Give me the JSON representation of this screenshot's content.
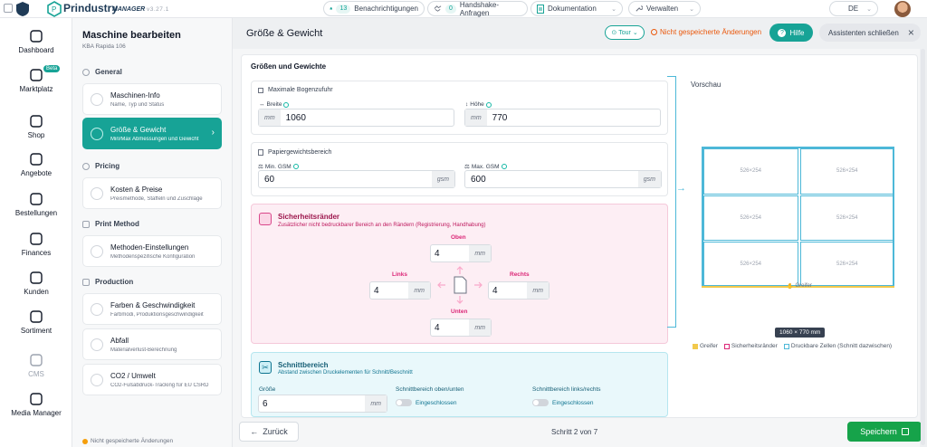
{
  "topbar": {
    "brand": "Prindustry",
    "brand_sub": "MANAGER",
    "version": "v3.27.1",
    "notifications": {
      "count": "13",
      "label": "Benachrichtigungen"
    },
    "handshake": {
      "count": "0",
      "label": "Handshake-Anfragen"
    },
    "docs_label": "Dokumentation",
    "manage_label": "Verwalten",
    "language": "DE"
  },
  "nav": [
    {
      "label": "Dashboard",
      "icon": "dashboard-icon"
    },
    {
      "label": "Marktplatz",
      "icon": "marketplace-icon",
      "badge": "Beta"
    },
    {
      "label": "Shop",
      "icon": "shop-icon"
    },
    {
      "label": "Angebote",
      "icon": "offers-icon"
    },
    {
      "label": "Bestellungen",
      "icon": "orders-icon"
    },
    {
      "label": "Finances",
      "icon": "finances-icon"
    },
    {
      "label": "Kunden",
      "icon": "customers-icon"
    },
    {
      "label": "Sortiment",
      "icon": "assortment-icon"
    },
    {
      "label": "CMS",
      "icon": "cms-icon"
    },
    {
      "label": "Media Manager",
      "icon": "media-icon"
    }
  ],
  "sidebar": {
    "title": "Maschine bearbeiten",
    "subtitle": "KBA Rapida 106",
    "sections": [
      {
        "name": "General",
        "items": [
          {
            "title": "Maschinen-Info",
            "sub": "Name, Typ und Status"
          },
          {
            "title": "Größe & Gewicht",
            "sub": "Min/Max Abmessungen und Gewicht",
            "active": true
          }
        ]
      },
      {
        "name": "Pricing",
        "items": [
          {
            "title": "Kosten & Preise",
            "sub": "Preismethode, Staffeln und Zuschläge"
          }
        ]
      },
      {
        "name": "Print Method",
        "items": [
          {
            "title": "Methoden-Einstellungen",
            "sub": "Methodenspezifische Konfiguration"
          }
        ]
      },
      {
        "name": "Production",
        "items": [
          {
            "title": "Farben & Geschwindigkeit",
            "sub": "Farbmodi, Produktionsgeschwindigkeit"
          },
          {
            "title": "Abfall",
            "sub": "Materialverlust-Berechnung"
          },
          {
            "title": "CO2 / Umwelt",
            "sub": "CO2-Fußabdruck-Tracking für EU CSRD"
          }
        ]
      }
    ],
    "footer": "Nicht gespeicherte Änderungen"
  },
  "header": {
    "title": "Größe & Gewicht",
    "tour": "Tour",
    "unsaved": "Nicht gespeicherte Änderungen",
    "help": "Hilfe",
    "close_assistant": "Assistenten schließen"
  },
  "form": {
    "section_title": "Größen und Gewichte",
    "max_sheet": {
      "title": "Maximale Bogenzufuhr",
      "width_label": "Breite",
      "width_unit": "mm",
      "width_value": "1060",
      "height_label": "Höhe",
      "height_unit": "mm",
      "height_value": "770"
    },
    "paper": {
      "title": "Papiergewichtsbereich",
      "min_label": "Min. GSM",
      "min_value": "60",
      "min_unit": "gsm",
      "max_label": "Max. GSM",
      "max_value": "600",
      "max_unit": "gsm"
    },
    "margins": {
      "title": "Sicherheitsränder",
      "sub": "Zusätzlicher nicht bedruckbarer Bereich an den Rändern (Registrierung, Handhabung)",
      "top_label": "Oben",
      "top_value": "4",
      "left_label": "Links",
      "left_value": "4",
      "right_label": "Rechts",
      "right_value": "4",
      "bottom_label": "Unten",
      "bottom_value": "4",
      "unit": "mm"
    },
    "cut": {
      "title": "Schnittbereich",
      "sub": "Abstand zwischen Druckelementen für Schnitt/Beschnitt",
      "size_label": "Größe",
      "size_value": "6",
      "size_unit": "mm",
      "tb_label": "Schnittbereich oben/unten",
      "tb_value": "Eingeschlossen",
      "lr_label": "Schnittbereich links/rechts",
      "lr_value": "Eingeschlossen"
    }
  },
  "preview": {
    "title": "Vorschau",
    "cells": [
      "526×254",
      "526×254",
      "526×254",
      "526×254",
      "526×254",
      "526×254"
    ],
    "gripper": "Greifer",
    "dimension": "1060 × 770 mm",
    "legend": [
      "Greifer",
      "Sicherheitsränder",
      "Druckbare Zellen (Schnitt dazwischen)"
    ]
  },
  "footer": {
    "back": "Zurück",
    "step": "Schritt 2 von 7",
    "save": "Speichern"
  },
  "colors": {
    "accent": "#17a396",
    "warning": "#ea580c",
    "pink": "#fdeef4",
    "cyan": "#e9f8fb",
    "preview_line": "#4db8d8",
    "gripper": "#f2c94c"
  }
}
